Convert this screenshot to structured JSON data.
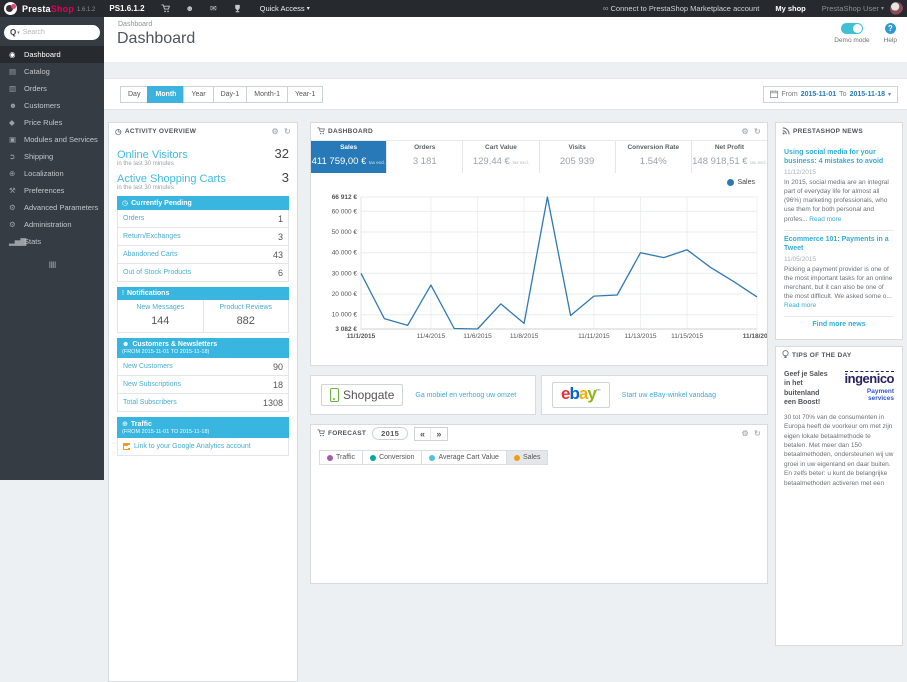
{
  "topbar": {
    "brand_first": "Presta",
    "brand_second": "Shop",
    "version": "1.6.1.2",
    "shop_name": "PS1.6.1.2",
    "quick_access": "Quick Access",
    "marketplace": "Connect to PrestaShop Marketplace account",
    "my_shop": "My shop",
    "user": "PrestaShop User"
  },
  "sidebar": {
    "search_prefix": "Q",
    "search_placeholder": "Search",
    "items": [
      {
        "label": "Dashboard"
      },
      {
        "label": "Catalog"
      },
      {
        "label": "Orders"
      },
      {
        "label": "Customers"
      },
      {
        "label": "Price Rules"
      },
      {
        "label": "Modules and Services"
      },
      {
        "label": "Shipping"
      },
      {
        "label": "Localization"
      },
      {
        "label": "Preferences"
      },
      {
        "label": "Advanced Parameters"
      },
      {
        "label": "Administration"
      },
      {
        "label": "Stats"
      }
    ]
  },
  "header": {
    "breadcrumb": "Dashboard",
    "title": "Dashboard",
    "demo_mode": "Demo mode",
    "help": "Help"
  },
  "toolbar": {
    "buttons": [
      "Day",
      "Month",
      "Year",
      "Day-1",
      "Month-1",
      "Year-1"
    ],
    "from": "From",
    "from_date": "2015-11-01",
    "to": "To",
    "to_date": "2015-11-18"
  },
  "activity": {
    "title": "ACTIVITY OVERVIEW",
    "online_visitors": {
      "label": "Online Visitors",
      "value": "32",
      "sub": "in the last 30 minutes"
    },
    "shopping_carts": {
      "label": "Active Shopping Carts",
      "value": "3",
      "sub": "in the last 30 minutes"
    },
    "pending": {
      "title": "Currently Pending",
      "rows": [
        {
          "label": "Orders",
          "value": "1"
        },
        {
          "label": "Return/Exchanges",
          "value": "3"
        },
        {
          "label": "Abandoned Carts",
          "value": "43"
        },
        {
          "label": "Out of Stock Products",
          "value": "6"
        }
      ]
    },
    "notifications": {
      "title": "Notifications",
      "cells": [
        {
          "label": "New Messages",
          "value": "144"
        },
        {
          "label": "Product Reviews",
          "value": "882"
        }
      ]
    },
    "customers": {
      "title": "Customers & Newsletters",
      "subtitle": "(FROM 2015-11-01 TO 2015-11-18)",
      "rows": [
        {
          "label": "New Customers",
          "value": "90"
        },
        {
          "label": "New Subscriptions",
          "value": "18"
        },
        {
          "label": "Total Subscribers",
          "value": "1308"
        }
      ]
    },
    "traffic": {
      "title": "Traffic",
      "subtitle": "(FROM 2015-11-01 TO 2015-11-18)",
      "link": "Link to your Google Analytics account"
    }
  },
  "dashboard": {
    "title": "DASHBOARD",
    "kpis": [
      {
        "label": "Sales",
        "value": "411 759,00 €",
        "suffix": "tax excl."
      },
      {
        "label": "Orders",
        "value": "3 181"
      },
      {
        "label": "Cart Value",
        "value": "129,44 €",
        "suffix": "tax excl."
      },
      {
        "label": "Visits",
        "value": "205 939"
      },
      {
        "label": "Conversion Rate",
        "value": "1.54%"
      },
      {
        "label": "Net Profit",
        "value": "148 918,51 €",
        "suffix": "tax excl."
      }
    ]
  },
  "chart_data": {
    "type": "line",
    "title": "Sales per day (November 2015)",
    "xlabel": "",
    "ylabel": "Sales (€)",
    "ylim": [
      3082,
      66912
    ],
    "grid": true,
    "legend_position": "top-right",
    "legend": [
      {
        "label": "Sales",
        "color": "#2f79b2"
      }
    ],
    "x": [
      "11/1/2015",
      "11/2/2015",
      "11/3/2015",
      "11/4/2015",
      "11/5/2015",
      "11/6/2015",
      "11/7/2015",
      "11/8/2015",
      "11/9/2015",
      "11/10/2015",
      "11/11/2015",
      "11/12/2015",
      "11/13/2015",
      "11/14/2015",
      "11/15/2015",
      "11/16/2015",
      "11/17/2015",
      "11/18/2015"
    ],
    "series": [
      {
        "name": "Sales",
        "color": "#2f79b2",
        "values": [
          30000,
          8100,
          4800,
          24300,
          3300,
          3082,
          15200,
          5800,
          66912,
          9600,
          19000,
          19500,
          40000,
          37600,
          41400,
          32900,
          26000,
          18600
        ]
      }
    ],
    "y_ticks": [
      {
        "v": 3082,
        "label": "3 082 €",
        "bold": true
      },
      {
        "v": 10000,
        "label": "10 000 €"
      },
      {
        "v": 20000,
        "label": "20 000 €"
      },
      {
        "v": 30000,
        "label": "30 000 €"
      },
      {
        "v": 40000,
        "label": "40 000 €"
      },
      {
        "v": 50000,
        "label": "50 000 €"
      },
      {
        "v": 60000,
        "label": "60 000 €"
      },
      {
        "v": 66912,
        "label": "66 912 €",
        "bold": true
      }
    ],
    "x_ticks": [
      {
        "i": 0,
        "label": "11/1/2015",
        "bold": true
      },
      {
        "i": 3,
        "label": "11/4/2015"
      },
      {
        "i": 5,
        "label": "11/6/2015"
      },
      {
        "i": 7,
        "label": "11/8/2015"
      },
      {
        "i": 10,
        "label": "11/11/2015"
      },
      {
        "i": 12,
        "label": "11/13/2015"
      },
      {
        "i": 14,
        "label": "11/15/2015"
      },
      {
        "i": 17,
        "label": "11/18/201",
        "bold": true
      }
    ]
  },
  "banners": {
    "shopgate": {
      "name": "Shopgate",
      "link": "Ga mobiel en verhoog uw omzet"
    },
    "ebay": {
      "e": "e",
      "b": "b",
      "a": "a",
      "y": "y",
      "tm": "™",
      "link": "Start uw eBay-winkel vandaag"
    }
  },
  "forecast": {
    "title": "FORECAST",
    "year": "2015",
    "prev": "«",
    "next": "»",
    "legend": [
      {
        "label": "Traffic",
        "color": "#a55ca8"
      },
      {
        "label": "Conversion",
        "color": "#00a99d"
      },
      {
        "label": "Average Cart Value",
        "color": "#4fc2e0"
      },
      {
        "label": "Sales",
        "color": "#f39c12"
      }
    ]
  },
  "news": {
    "title": "PRESTASHOP NEWS",
    "items": [
      {
        "title": "Using social media for your business: 4 mistakes to avoid",
        "date": "11/12/2015",
        "excerpt": "In 2015, social media are an integral part of everyday life for almost all (96%) marketing professionals, who use them for both personal and profes...",
        "read_more": "Read more"
      },
      {
        "title": "Ecommerce 101: Payments in a Tweet",
        "date": "11/05/2015",
        "excerpt": "Picking a payment provider is one of the most important tasks for an online merchant, but it can also be one of the most difficult. We asked some o...",
        "read_more": "Read more"
      }
    ],
    "more": "Find more news"
  },
  "tips": {
    "title": "TIPS OF THE DAY",
    "heading": "Geef je Sales in het buitenland een Boost!",
    "logo": "ingenico",
    "logo_sub1": "Payment",
    "logo_sub2": "services",
    "body": "30 tot 70% van de consumenten in Europa heeft de voorkeur om met zijn eigen lokale betaalmethode te betalen. Met meer dan 150 betaalmethoden, ondersteunen wij uw groei in uw eigenland en daar buiten. En zelfs beter: u kunt de belangrijke betaalmethoden activeren met een"
  },
  "icons": {
    "search": "Q",
    "caret": "▾",
    "gear": "⚙",
    "refresh": "↻",
    "clock": "◷",
    "bang": "!",
    "person": "☻",
    "globe": "⊕",
    "collapse": "‖‖",
    "chain": "∞",
    "envelope": "✉",
    "dashboard": "◉",
    "catalog": "▤",
    "orders": "▥",
    "customers": "☻",
    "price_rules": "◆",
    "modules": "▣",
    "shipping": "➲",
    "localization": "⊕",
    "preferences": "⚒",
    "advanced": "⚙",
    "administration": "⚙",
    "stats": "▂▅▇"
  },
  "colors": {
    "topbar_bg": "#262a2f",
    "sidebar_bg": "#363c44",
    "section_header_blue": "#38b6df",
    "link_blue": "#41aed6",
    "kpi_active_blue": "#2779b7",
    "chart_line_blue": "#2f79b2",
    "brand_pink": "#e0005a",
    "toggle_teal": "#3ec1d4",
    "button_active_blue": "#3cb2de"
  }
}
